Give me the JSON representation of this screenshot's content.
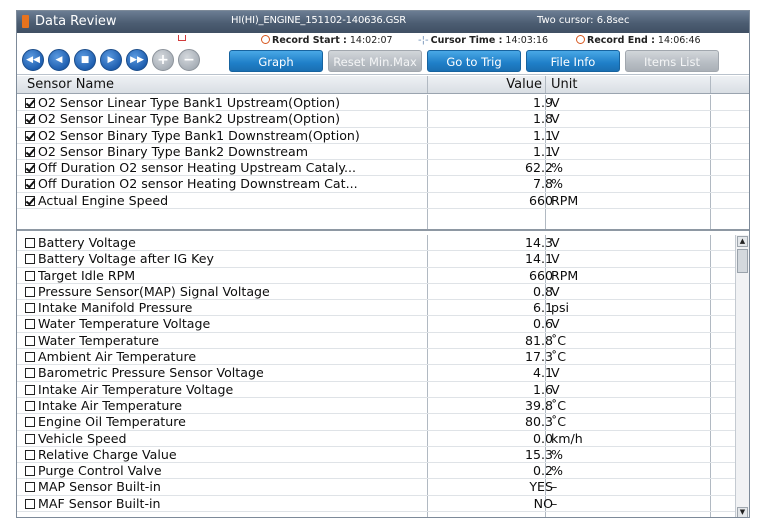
{
  "titlebar": {
    "title": "Data Review",
    "file": "HI(HI)_ENGINE_151102-140636.GSR",
    "cursor_info": "Two cursor: 6.8sec"
  },
  "timeline": {
    "record_start_label": "Record Start :",
    "record_start_value": "14:02:07",
    "cursor_time_label": "Cursor Time :",
    "cursor_time_value": "14:03:16",
    "record_end_label": "Record End :",
    "record_end_value": "14:06:46"
  },
  "nav": {
    "first": "first-icon",
    "prev": "previous-icon",
    "stop": "stop-icon",
    "next": "next-icon",
    "last": "last-icon",
    "zoom_in": "plus-icon",
    "zoom_out": "minus-icon"
  },
  "toolbar": {
    "graph": "Graph",
    "reset": "Reset Min.Max",
    "go_to_trig": "Go to Trig",
    "file_info": "File Info",
    "items_list": "Items List"
  },
  "header": {
    "sensor_name": "Sensor Name",
    "value": "Value",
    "unit": "Unit"
  },
  "selected_rows": [
    {
      "name": "O2 Sensor Linear Type Bank1 Upstream(Option)",
      "value": "1.9",
      "unit": "V"
    },
    {
      "name": "O2 Sensor Linear Type Bank2 Upstream(Option)",
      "value": "1.8",
      "unit": "V"
    },
    {
      "name": "O2 Sensor Binary Type Bank1 Downstream(Option)",
      "value": "1.1",
      "unit": "V"
    },
    {
      "name": "O2 Sensor Binary Type Bank2 Downstream",
      "value": "1.1",
      "unit": "V"
    },
    {
      "name": "Off Duration O2 sensor Heating Upstream Cataly...",
      "value": "62.2",
      "unit": "%"
    },
    {
      "name": "Off Duration O2 sensor Heating Downstream Cat...",
      "value": "7.8",
      "unit": "%"
    },
    {
      "name": "Actual Engine Speed",
      "value": "660",
      "unit": "RPM"
    }
  ],
  "all_rows": [
    {
      "name": "Battery Voltage",
      "value": "14.3",
      "unit": "V"
    },
    {
      "name": "Battery Voltage after IG Key",
      "value": "14.1",
      "unit": "V"
    },
    {
      "name": "Target Idle RPM",
      "value": "660",
      "unit": "RPM"
    },
    {
      "name": "Pressure Sensor(MAP) Signal Voltage",
      "value": "0.8",
      "unit": "V"
    },
    {
      "name": "Intake Manifold Pressure",
      "value": "6.1",
      "unit": "psi"
    },
    {
      "name": "Water Temperature Voltage",
      "value": "0.6",
      "unit": "V"
    },
    {
      "name": "Water Temperature",
      "value": "81.8",
      "unit": "˚C"
    },
    {
      "name": "Ambient Air Temperature",
      "value": "17.3",
      "unit": "˚C"
    },
    {
      "name": "Barometric Pressure Sensor Voltage",
      "value": "4.1",
      "unit": "V"
    },
    {
      "name": "Intake Air Temperature Voltage",
      "value": "1.6",
      "unit": "V"
    },
    {
      "name": "Intake Air Temperature",
      "value": "39.8",
      "unit": "˚C"
    },
    {
      "name": "Engine Oil Temperature",
      "value": "80.3",
      "unit": "˚C"
    },
    {
      "name": "Vehicle Speed",
      "value": "0.0",
      "unit": "km/h"
    },
    {
      "name": "Relative Charge Value",
      "value": "15.3",
      "unit": "%"
    },
    {
      "name": "Purge Control Valve",
      "value": "0.2",
      "unit": "%"
    },
    {
      "name": "MAP Sensor Built-in",
      "value": "YES",
      "unit": "–"
    },
    {
      "name": "MAF Sensor Built-in",
      "value": "NO",
      "unit": "–"
    }
  ],
  "colors": {
    "accent_button": "#1f7fc8",
    "nav_button": "#1f5fb0",
    "title_bar": "#4c5d72",
    "app_mark": "#e8731e"
  }
}
